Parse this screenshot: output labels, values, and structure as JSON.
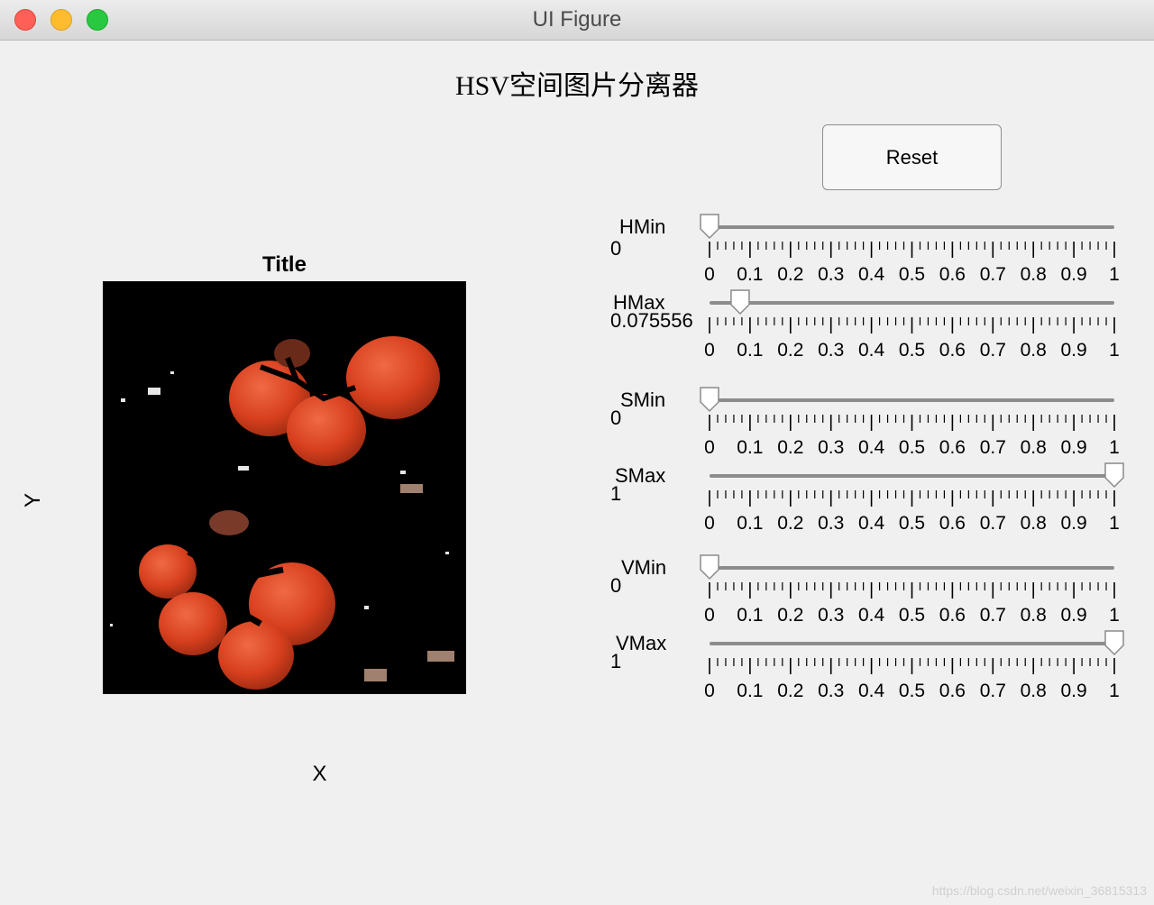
{
  "window": {
    "title": "UI Figure"
  },
  "app": {
    "title": "HSV空间图片分离器"
  },
  "buttons": {
    "reset": "Reset"
  },
  "axes": {
    "title": "Title",
    "xlabel": "X",
    "ylabel": "Y"
  },
  "tick_labels": [
    "0",
    "0.1",
    "0.2",
    "0.3",
    "0.4",
    "0.5",
    "0.6",
    "0.7",
    "0.8",
    "0.9",
    "1"
  ],
  "sliders": [
    {
      "label": "HMin",
      "value_text": "0",
      "value": 0
    },
    {
      "label": "HMax",
      "value_text": "0.075556",
      "value": 0.075556
    },
    {
      "label": "SMin",
      "value_text": "0",
      "value": 0
    },
    {
      "label": "SMax",
      "value_text": "1",
      "value": 1
    },
    {
      "label": "VMin",
      "value_text": "0",
      "value": 0
    },
    {
      "label": "VMax",
      "value_text": "1",
      "value": 1
    }
  ],
  "watermark": "https://blog.csdn.net/weixin_36815313"
}
